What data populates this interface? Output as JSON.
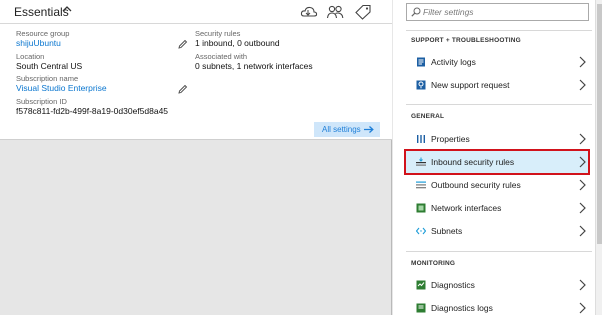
{
  "essentials": {
    "title": "Essentials",
    "resource_group": {
      "label": "Resource group",
      "value": "shijuUbuntu"
    },
    "location": {
      "label": "Location",
      "value": "South Central US"
    },
    "subscription_name": {
      "label": "Subscription name",
      "value": "Visual Studio Enterprise"
    },
    "subscription_id": {
      "label": "Subscription ID",
      "value": "f578c811-fd2b-499f-8a19-0d30ef5d8a45"
    },
    "security_rules": {
      "label": "Security rules",
      "value": "1 inbound, 0 outbound"
    },
    "associated_with": {
      "label": "Associated with",
      "value": "0 subnets, 1 network interfaces"
    },
    "all_settings_label": "All settings"
  },
  "settings": {
    "filter_placeholder": "Filter settings",
    "sections": {
      "support": {
        "title": "SUPPORT + TROUBLESHOOTING",
        "items": [
          "Activity logs",
          "New support request"
        ]
      },
      "general": {
        "title": "GENERAL",
        "items": [
          "Properties",
          "Inbound security rules",
          "Outbound security rules",
          "Network interfaces",
          "Subnets"
        ]
      },
      "monitoring": {
        "title": "MONITORING",
        "items": [
          "Diagnostics",
          "Diagnostics logs"
        ]
      }
    },
    "selected_item": "Inbound security rules"
  },
  "colors": {
    "link": "#0a76cf",
    "selected_bg": "#d8eefa",
    "highlight_border": "#d1121b",
    "all_settings_bg": "#cfe6fa"
  }
}
